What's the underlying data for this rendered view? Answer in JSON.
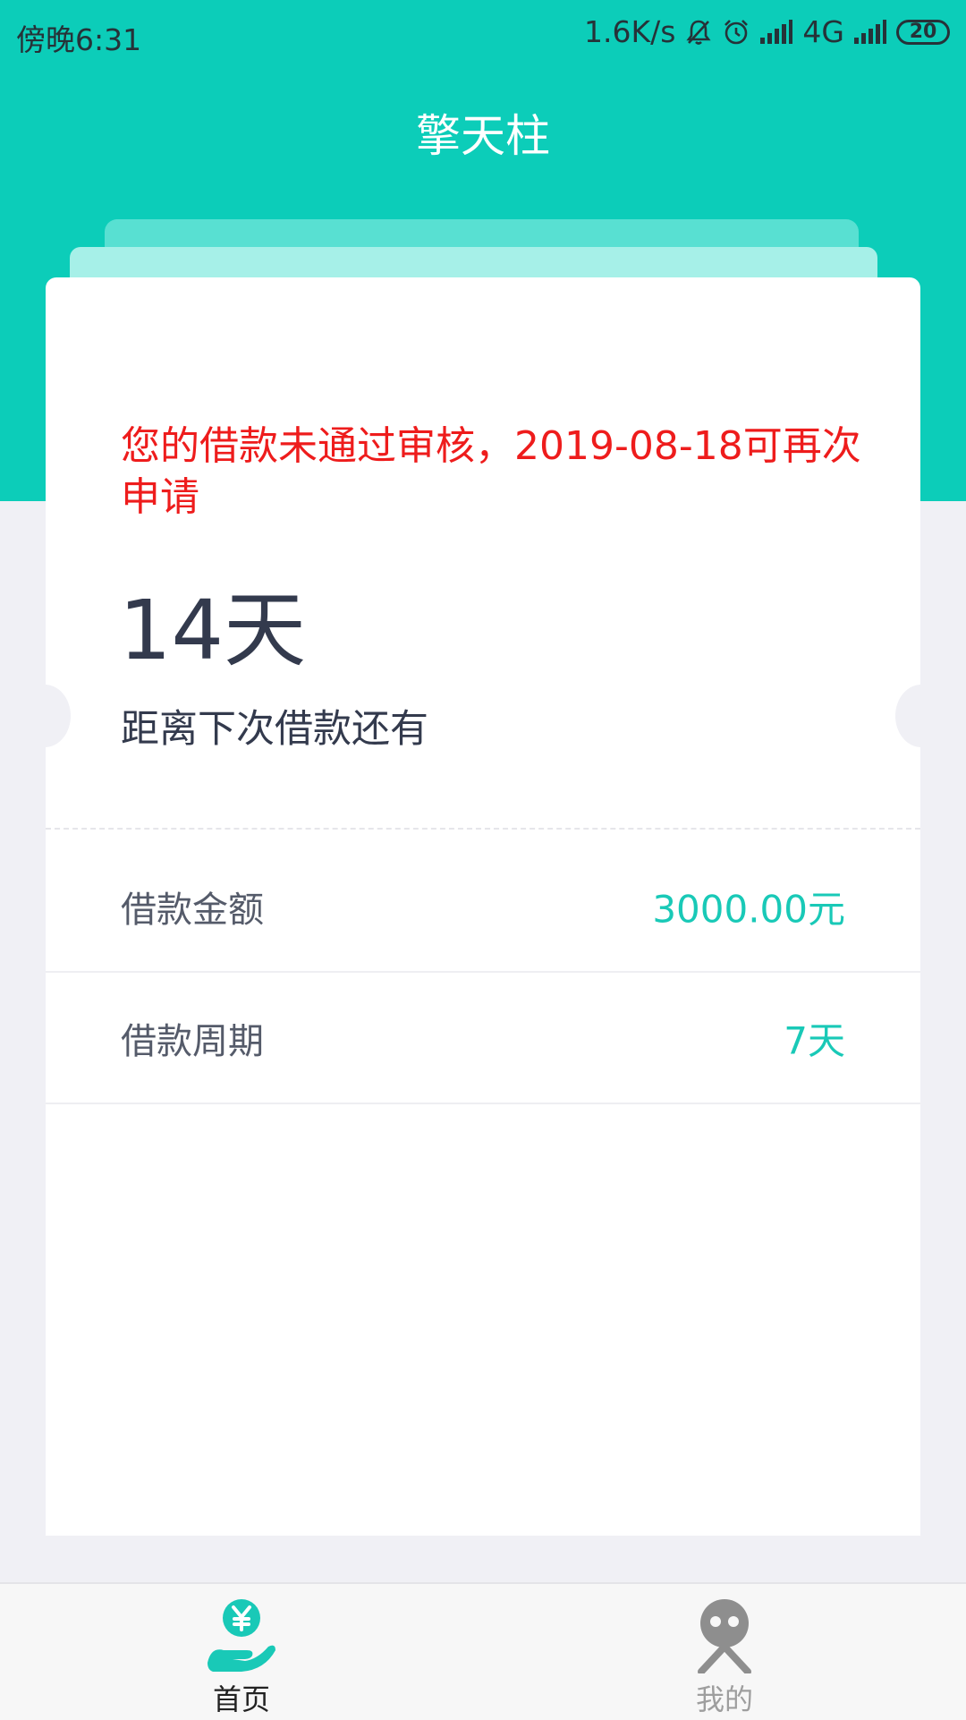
{
  "status_bar": {
    "time": "傍晚6:31",
    "net_speed": "1.6K/s",
    "network_type": "4G",
    "battery": "20"
  },
  "header": {
    "title": "擎天柱"
  },
  "card": {
    "reject_message": "您的借款未通过审核，2019-08-18可再次申请",
    "days_value": "14天",
    "days_caption": "距离下次借款还有",
    "rows": [
      {
        "label": "借款金额",
        "value": "3000.00元"
      },
      {
        "label": "借款周期",
        "value": "7天"
      }
    ]
  },
  "bottom_nav": {
    "items": [
      {
        "label": "首页",
        "icon": "hand-yuan-icon",
        "active": true
      },
      {
        "label": "我的",
        "icon": "person-icon",
        "active": false
      }
    ]
  },
  "colors": {
    "brand": "#0ccdb9",
    "accent_value": "#19c9b7",
    "error": "#ee1c1c",
    "background": "#f0f0f5"
  }
}
